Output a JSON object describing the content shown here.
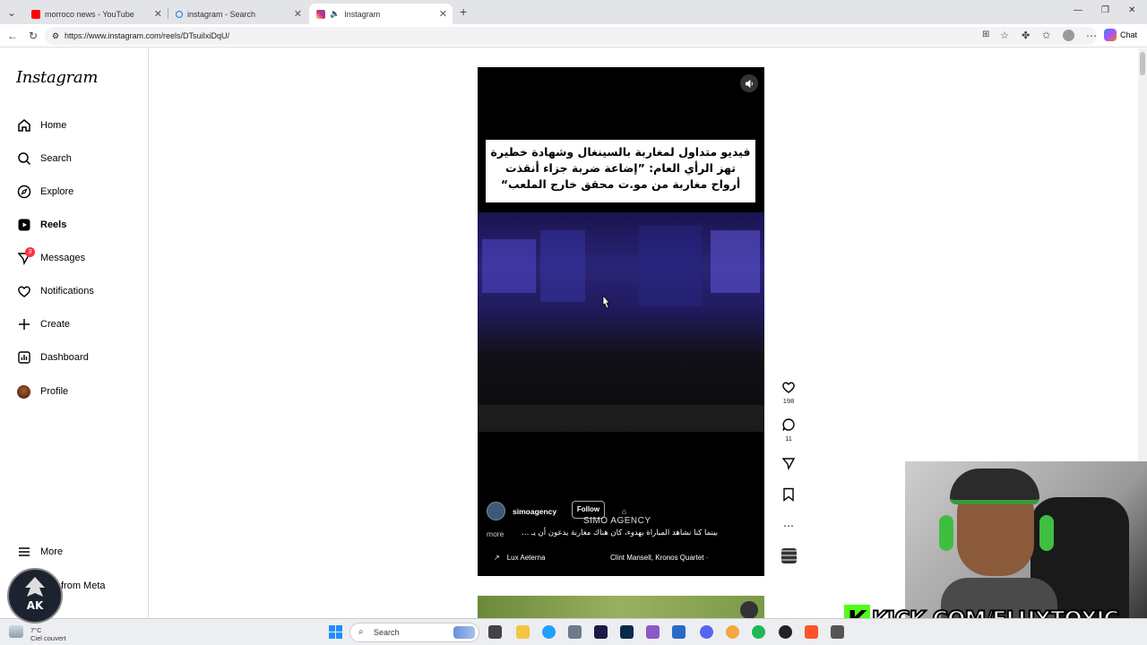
{
  "browser": {
    "tabs": [
      {
        "title": "morroco news - YouTube",
        "color": "#ff0000"
      },
      {
        "title": "instagram - Search",
        "color": "#1a73e8"
      },
      {
        "title": "Instagram",
        "color": "#e1306c",
        "active": true
      }
    ],
    "url": "https://www.instagram.com/reels/DTsuiIxiDqU/",
    "chat_label": "Chat"
  },
  "sidebar": {
    "logo": "Instagram",
    "items": [
      {
        "label": "Home",
        "icon": "home-icon"
      },
      {
        "label": "Search",
        "icon": "search-icon"
      },
      {
        "label": "Explore",
        "icon": "compass-icon"
      },
      {
        "label": "Reels",
        "icon": "reels-icon",
        "active": true
      },
      {
        "label": "Messages",
        "icon": "messenger-icon",
        "badge": "3"
      },
      {
        "label": "Notifications",
        "icon": "heart-icon"
      },
      {
        "label": "Create",
        "icon": "plus-icon"
      },
      {
        "label": "Dashboard",
        "icon": "dashboard-icon"
      },
      {
        "label": "Profile",
        "icon": "avatar-icon"
      }
    ],
    "more": "More",
    "also_from_meta": "from Meta"
  },
  "reel": {
    "caption_lines": [
      "فيديو متداول لمغاربة بالسينغال وشهادة خطيرة",
      "تهز الرأي العام: ”إضاعة ضربة جزاء أنقذت",
      "أرواح مغاربة من مو.ت محقق خارج الملعب“"
    ],
    "username": "simoagency",
    "follow_label": "Follow",
    "watermark": "SIMO AGENCY",
    "description": "بينما كنا نشاهد المباراة بهدوء، كان هناك مغاربة يدعون أن يـ ...",
    "more_label": "more",
    "audio": "Lux Aeterna",
    "music": "Clint Mansell, Kronos Quartet ·",
    "likes": "198",
    "comments": "11"
  },
  "overlay": {
    "kick_text": "KICK.COM/FLUXTOXIC",
    "kick_letter": "K"
  },
  "taskbar": {
    "search_placeholder": "Search",
    "weather_temp": "7°C",
    "weather_desc": "Ciel couvert"
  },
  "colors": {
    "instagram_badge": "#ff3040",
    "kick_green": "#53fc18"
  }
}
